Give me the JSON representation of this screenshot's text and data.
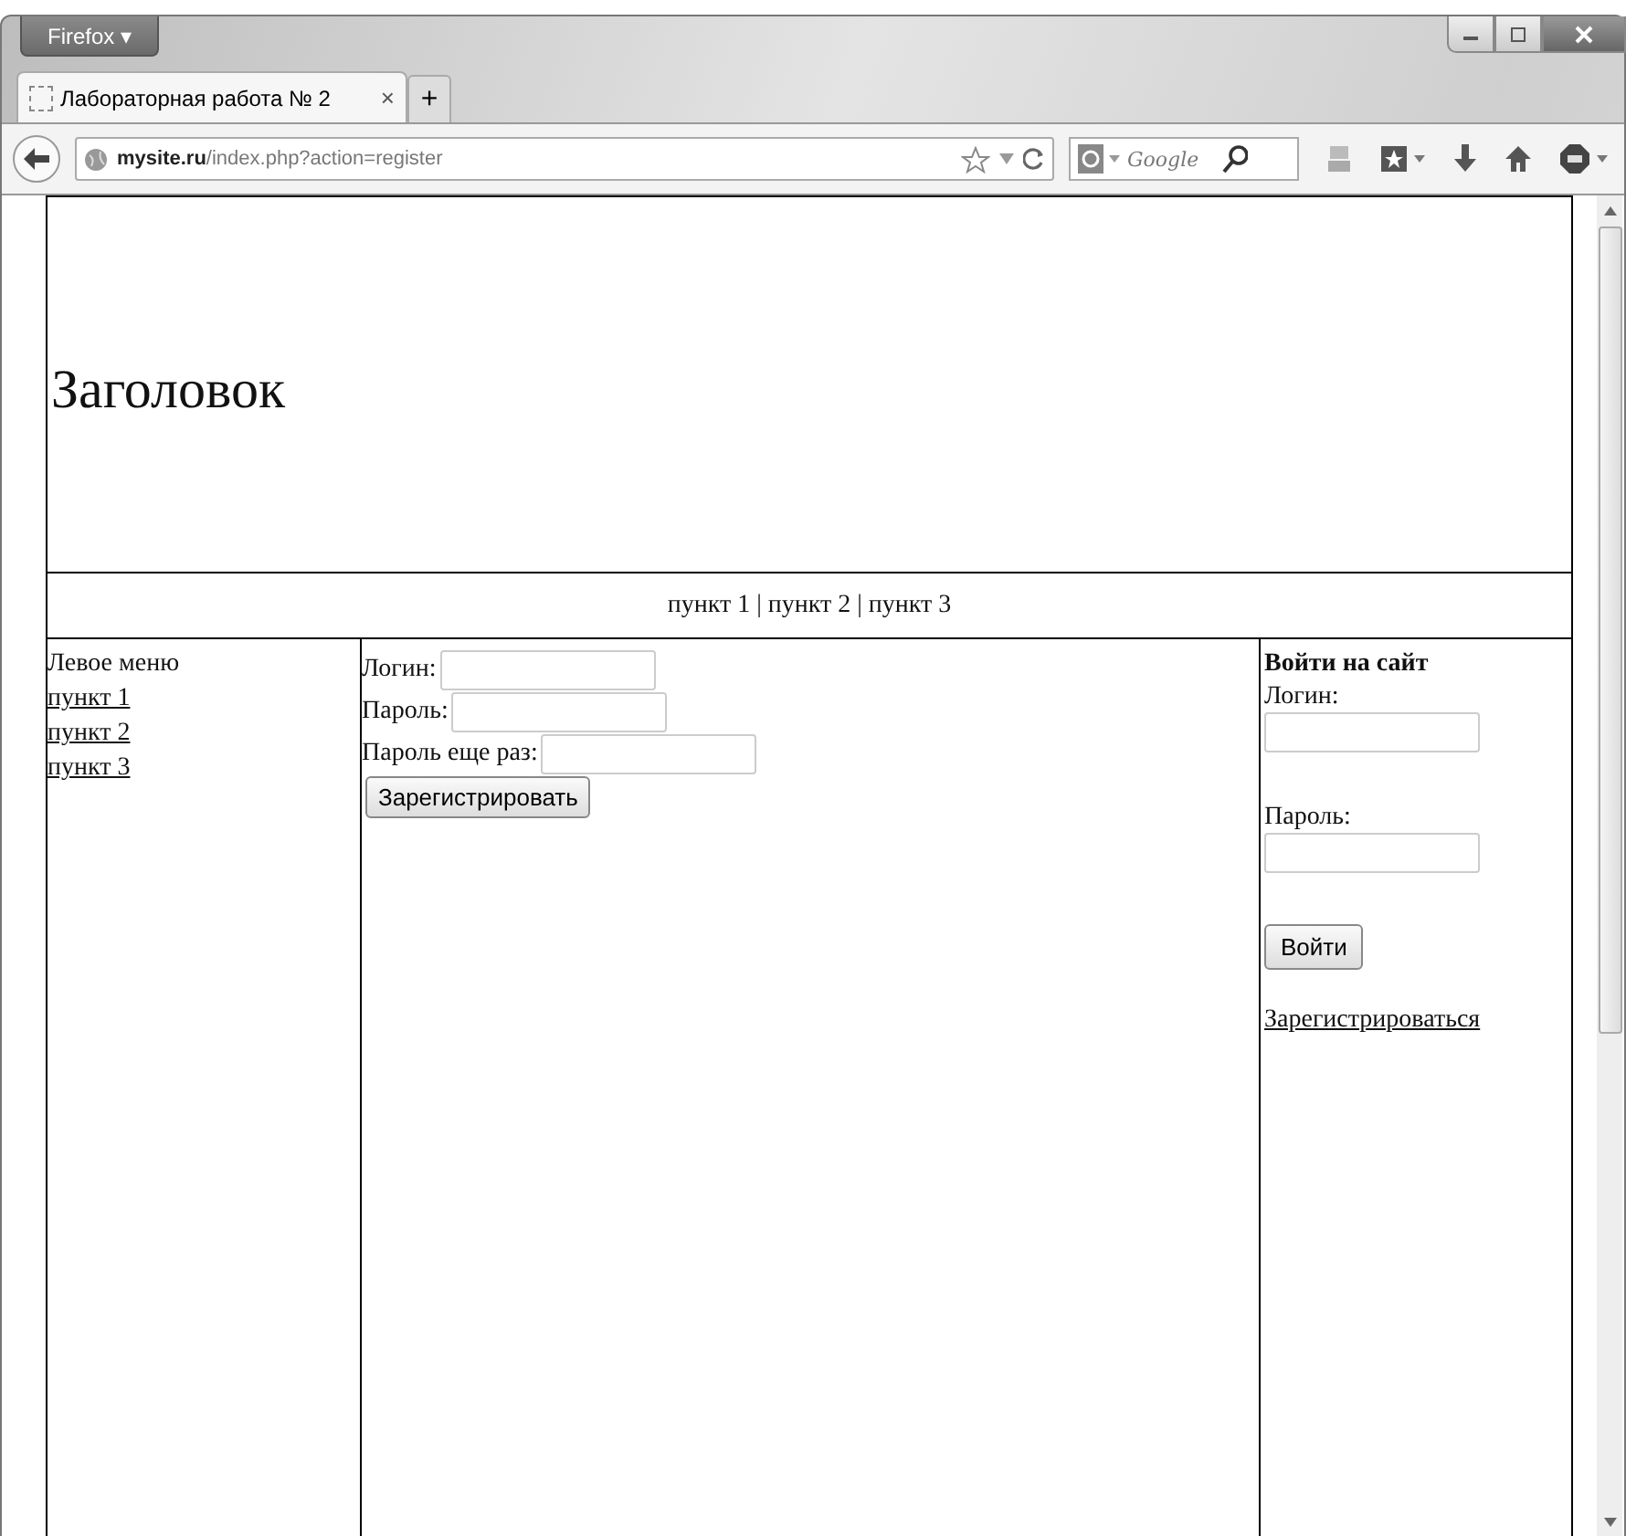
{
  "browser": {
    "menu_button": "Firefox ▾",
    "tabs": [
      {
        "label": "Лабораторная работа № 2",
        "selected": true
      }
    ],
    "new_tab": "+",
    "close_tab": "×",
    "address": {
      "domain": "mysite.ru",
      "path": "/index.php?action=register"
    },
    "search": {
      "placeholder": "Google"
    }
  },
  "page": {
    "header": "Заголовок",
    "top_menu": "пункт 1 | пункт 2 | пункт 3",
    "left_menu": {
      "title": "Левое меню",
      "items": [
        "пункт 1",
        "пункт 2",
        "пункт 3"
      ]
    },
    "register_form": {
      "fields": [
        {
          "label": "Логин:"
        },
        {
          "label": "Пароль:"
        },
        {
          "label": "Пароль еще раз:"
        }
      ],
      "button": "Зарегистрировать"
    },
    "login_box": {
      "title": "Войти на сайт",
      "fields": [
        {
          "label": "Логин:"
        },
        {
          "label": "Пароль:"
        }
      ],
      "button": "Войти",
      "link": "Зарегистрироваться"
    }
  }
}
